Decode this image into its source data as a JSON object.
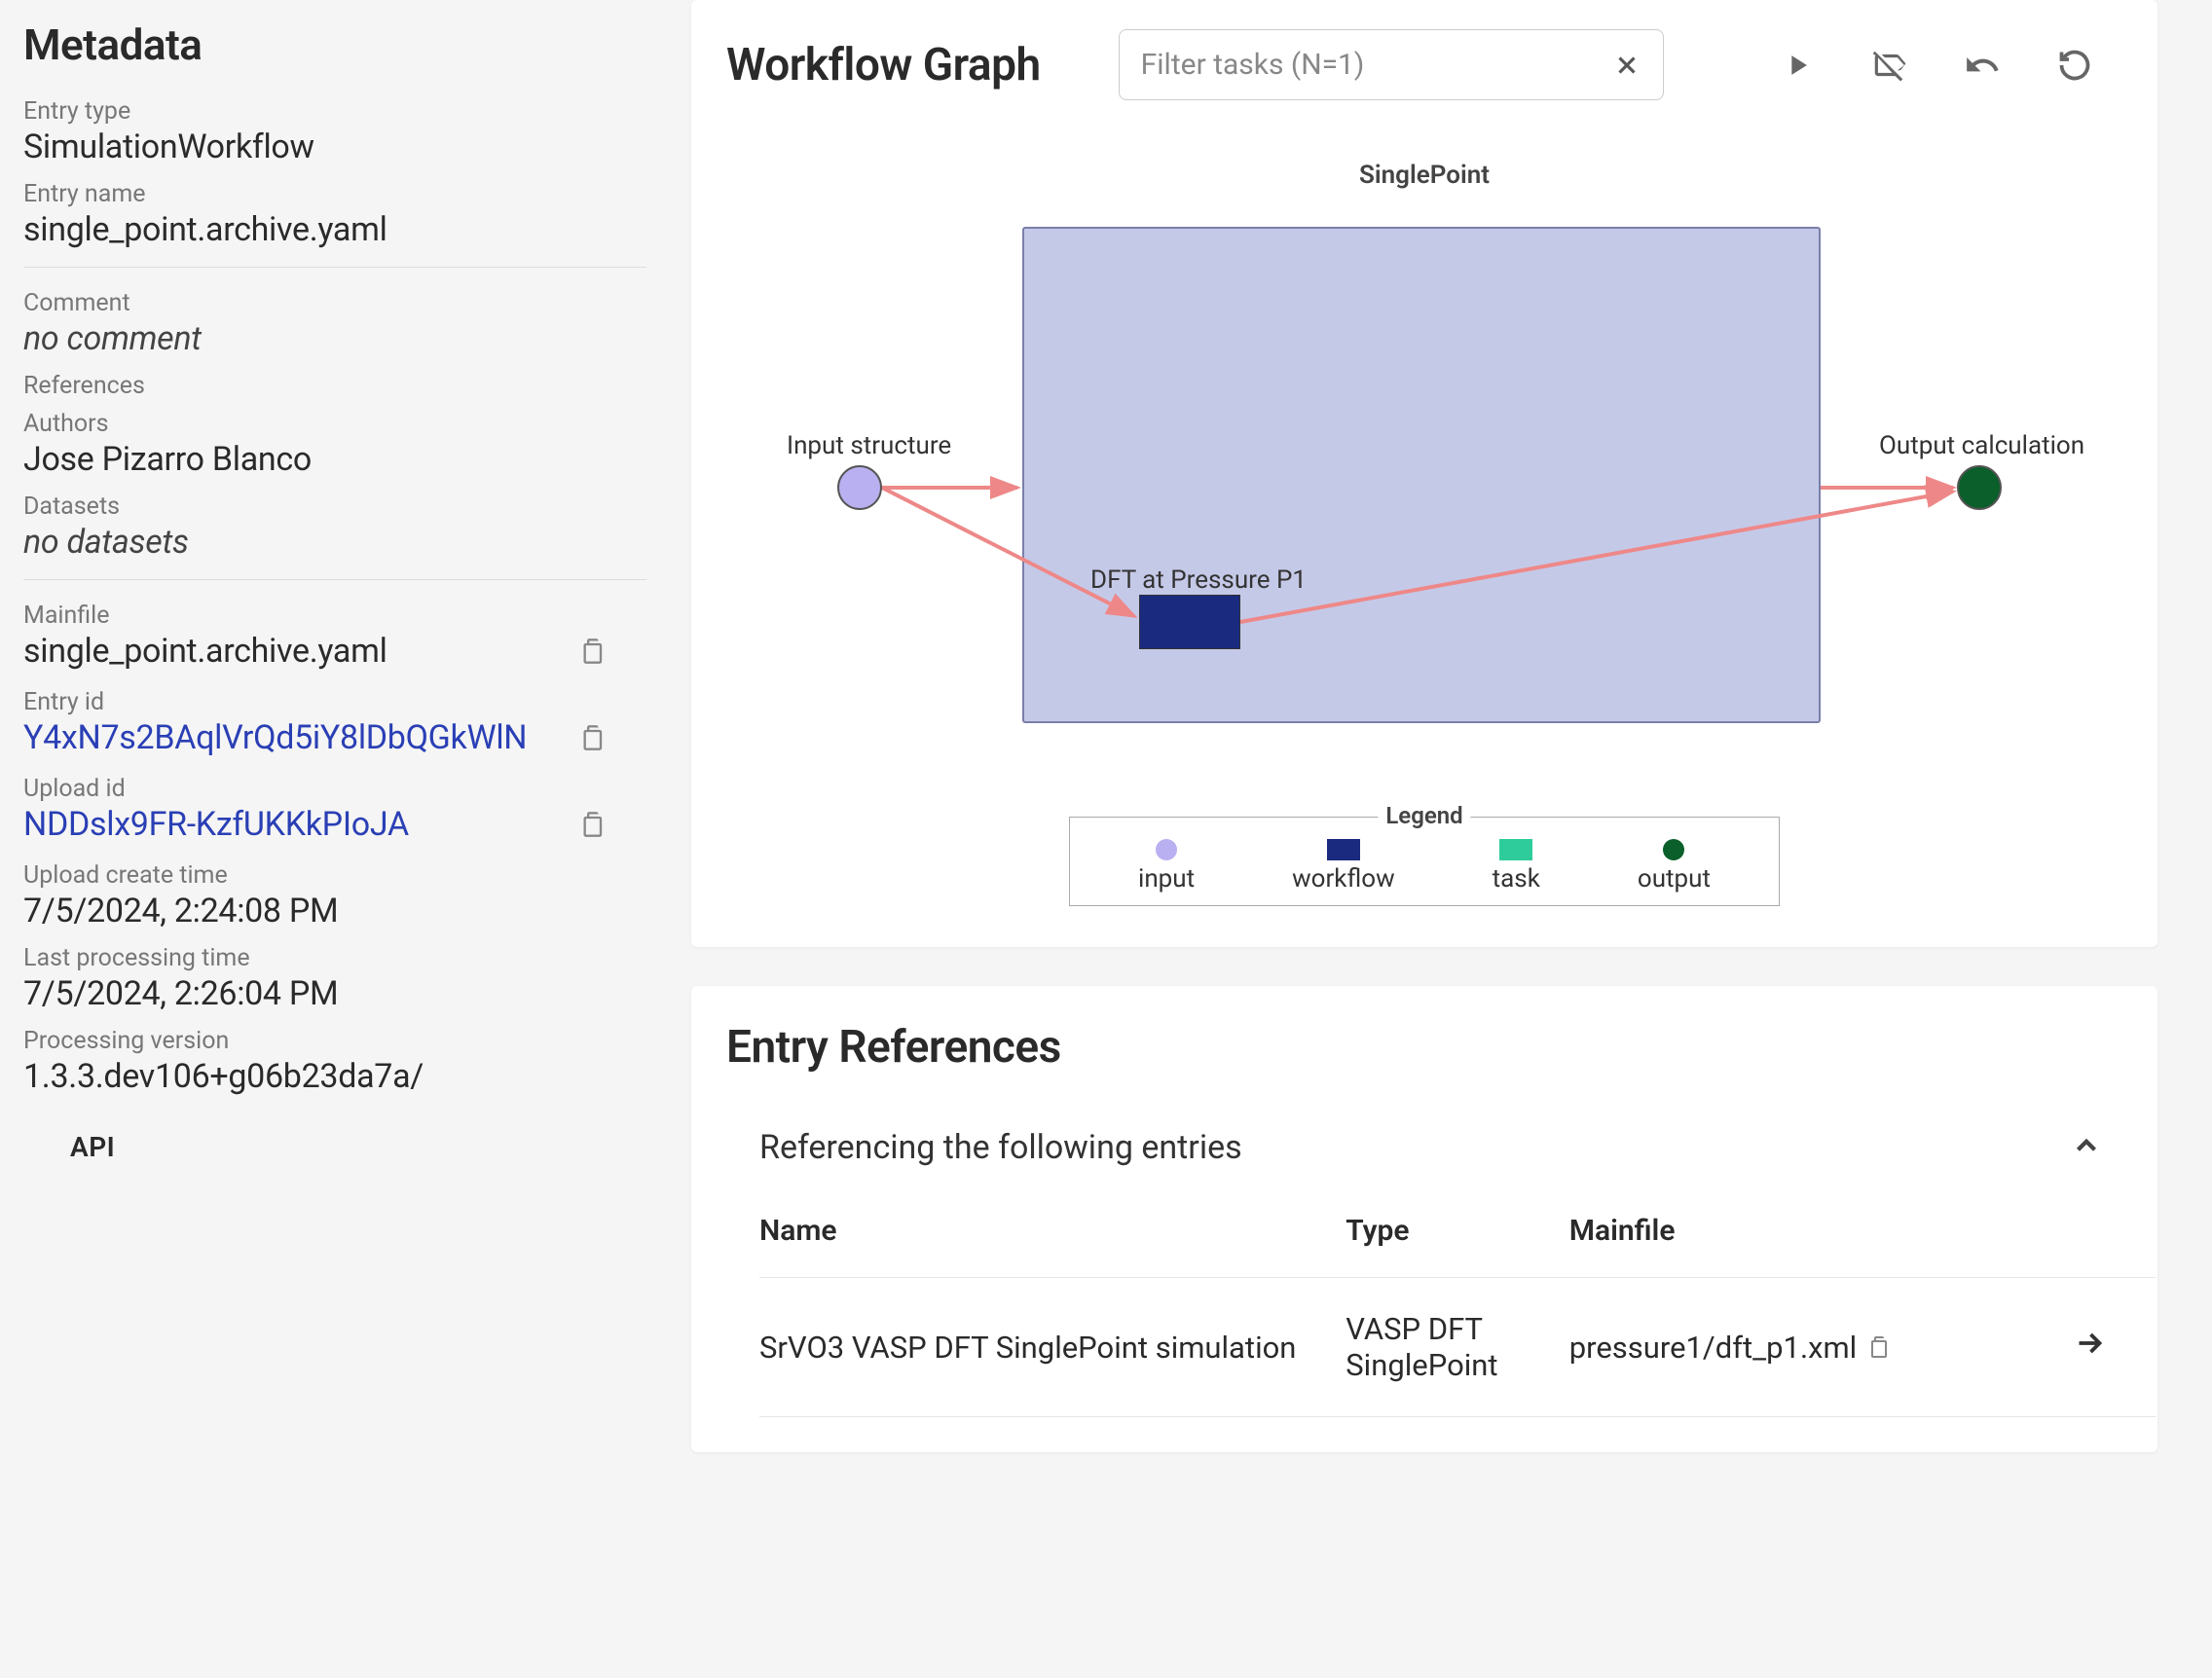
{
  "sidebar": {
    "title": "Metadata",
    "entry_type_label": "Entry type",
    "entry_type": "SimulationWorkflow",
    "entry_name_label": "Entry name",
    "entry_name": "single_point.archive.yaml",
    "comment_label": "Comment",
    "comment": "no comment",
    "references_label": "References",
    "authors_label": "Authors",
    "authors": "Jose Pizarro Blanco",
    "datasets_label": "Datasets",
    "datasets": "no datasets",
    "mainfile_label": "Mainfile",
    "mainfile": "single_point.archive.yaml",
    "entry_id_label": "Entry id",
    "entry_id": "Y4xN7s2BAqlVrQd5iY8lDbQGkWlN",
    "upload_id_label": "Upload id",
    "upload_id": "NDDslx9FR-KzfUKKkPIoJA",
    "upload_create_label": "Upload create time",
    "upload_create": "7/5/2024, 2:24:08 PM",
    "last_processing_label": "Last processing time",
    "last_processing": "7/5/2024, 2:26:04 PM",
    "processing_version_label": "Processing version",
    "processing_version": "1.3.3.dev106+g06b23da7a/",
    "api_label": "API"
  },
  "workflow": {
    "title": "Workflow Graph",
    "filter_placeholder": "Filter tasks (N=1)",
    "graph_label": "SinglePoint",
    "input_label": "Input structure",
    "output_label": "Output calculation",
    "task_label": "DFT at Pressure P1",
    "legend_title": "Legend",
    "legend": {
      "input": "input",
      "workflow": "workflow",
      "task": "task",
      "output": "output"
    }
  },
  "refs": {
    "title": "Entry References",
    "subheader": "Referencing the following entries",
    "columns": {
      "name": "Name",
      "type": "Type",
      "mainfile": "Mainfile"
    },
    "rows": [
      {
        "name": "SrVO3 VASP DFT SinglePoint simulation",
        "type": "VASP DFT SinglePoint",
        "mainfile": "pressure1/dft_p1.xml"
      }
    ]
  }
}
